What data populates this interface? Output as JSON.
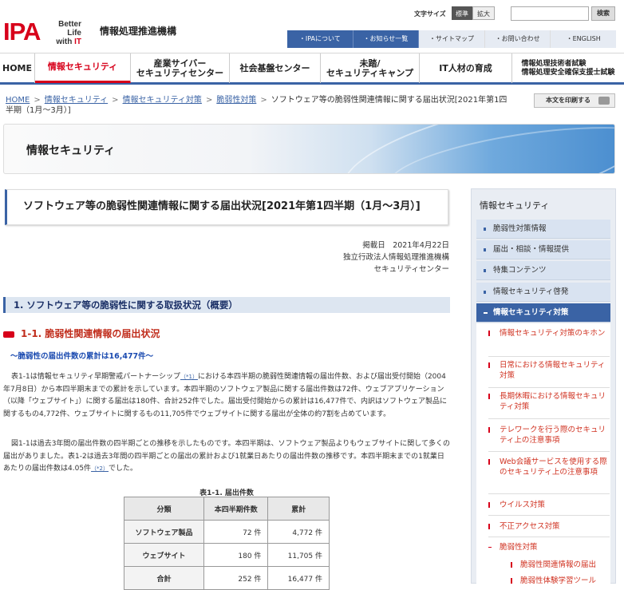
{
  "header": {
    "logo": "IPA",
    "tagline_line1": "Better Life",
    "tagline_line2_prefix": "with",
    "tagline_line2_it": "IT",
    "org_name": "情報処理推進機構",
    "font_size_label": "文字サイズ",
    "font_size_standard": "標準",
    "font_size_large": "拡大",
    "search_button": "検索",
    "utility_nav": [
      "・IPAについて",
      "・お知らせ一覧",
      "・サイトマップ",
      "・お問い合わせ",
      "・ENGLISH"
    ]
  },
  "main_nav": [
    "HOME",
    "情報セキュリティ",
    "産業サイバー\nセキュリティセンター",
    "社会基盤センター",
    "未踏/\nセキュリティキャンプ",
    "IT人材の育成",
    "情報処理技術者試験\n情報処理安全確保支援士試験"
  ],
  "breadcrumb": {
    "items": [
      "HOME",
      "情報セキュリティ",
      "情報セキュリティ対策",
      "脆弱性対策"
    ],
    "current": "ソフトウェア等の脆弱性関連情報に関する届出状況[2021年第1四半期（1月～3月）]",
    "separator": ">"
  },
  "print_button": "本文を印刷する",
  "banner_title": "情報セキュリティ",
  "page_title": "ソフトウェア等の脆弱性関連情報に関する届出状況[2021年第1四半期（1月～3月）]",
  "meta": {
    "date": "掲載日　2021年4月22日",
    "org": "独立行政法人情報処理推進機構",
    "dept": "セキュリティセンター"
  },
  "section_heading": "1. ソフトウェア等の脆弱性に関する取扱状況（概要）",
  "subsection_heading": "1-1. 脆弱性関連情報の届出状況",
  "lead": "～脆弱性の届出件数の累計は16,477件～",
  "para1": {
    "a": "表1-1は情報セキュリティ早期警戒パートナーシップ",
    "sup": "（*1）",
    "b": "における本四半期の脆弱性関連情報の届出件数、および届出受付開始（2004年7月8日）から本四半期末までの累計を示しています。本四半期のソフトウェア製品に関する届出件数は72件、ウェブアプリケーション（以降「ウェブサイト」）に関する届出は180件、合計252件でした。届出受付開始からの累計は16,477件で、内訳はソフトウェア製品に関するもの4,772件、ウェブサイトに関するもの11,705件でウェブサイトに関する届出が全体の約7割を占めています。"
  },
  "para2": {
    "a": "図1-1は過去3年間の届出件数の四半期ごとの推移を示したものです。本四半期は、ソフトウェア製品よりもウェブサイトに関して多くの届出がありました。表1-2は過去3年間の四半期ごとの届出の累計および1就業日あたりの届出件数の推移です。本四半期末までの1就業日あたりの届出件数は4.05件",
    "sup": "（*2）",
    "b": "でした。"
  },
  "table": {
    "caption": "表1-1. 届出件数",
    "headers": [
      "分類",
      "本四半期件数",
      "累計"
    ],
    "rows": [
      {
        "label": "ソフトウェア製品",
        "quarter": "72 件",
        "total": "4,772 件"
      },
      {
        "label": "ウェブサイト",
        "quarter": "180 件",
        "total": "11,705 件"
      },
      {
        "label": "合計",
        "quarter": "252 件",
        "total": "16,477 件"
      }
    ]
  },
  "sidebar": {
    "heading": "情報セキュリティ",
    "items": [
      "脆弱性対策情報",
      "届出・相談・情報提供",
      "特集コンテンツ",
      "情報セキュリティ啓発",
      "情報セキュリティ対策"
    ],
    "active_index": 4,
    "subitems": [
      "情報セキュリティ対策のキホン",
      "日常における情報セキュリティ対策",
      "長期休暇における情報セキュリティ対策",
      "テレワークを行う際のセキュリティ上の注意事項",
      "Web会議サービスを使用する際のセキュリティ上の注意事項",
      "ウイルス対策",
      "不正アクセス対策",
      "脆弱性対策"
    ],
    "subsubitems": [
      "脆弱性関連情報の届出",
      "脆弱性体験学習ツール"
    ]
  },
  "colors": {
    "brand_red": "#d7001a",
    "nav_blue": "#3a63a5",
    "link_blue": "#1a4ab0"
  }
}
